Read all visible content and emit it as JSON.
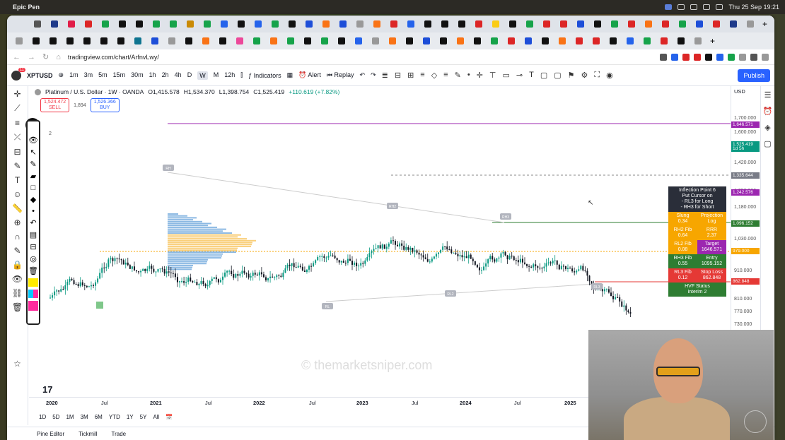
{
  "menubar": {
    "app_name": "Epic Pen",
    "datetime": "Thu 25 Sep  19:21"
  },
  "browser": {
    "url": "tradingview.com/chart/ArfnvLwy/"
  },
  "header": {
    "symbol": "XPTUSD",
    "avatar_badge": "11",
    "timeframes": [
      "1m",
      "3m",
      "5m",
      "15m",
      "30m",
      "1h",
      "2h",
      "4h",
      "D",
      "W",
      "M",
      "12h"
    ],
    "active_timeframe": "W",
    "indicators_label": "Indicators",
    "alert_label": "Alert",
    "replay_label": "Replay",
    "publish_label": "Publish"
  },
  "legend": {
    "title": "Platinum / U.S. Dollar · 1W · OANDA",
    "open": "O1,415.578",
    "high": "H1,534.370",
    "low": "L1,398.754",
    "close": "C1,525.419",
    "change": "+110.619 (+7.82%)"
  },
  "trade": {
    "sell_price": "1,524.472",
    "sell_label": "SELL",
    "spread": "1,894",
    "buy_price": "1,526.366",
    "buy_label": "BUY"
  },
  "price_axis": {
    "currency": "USD",
    "ticks": [
      "1,700.000",
      "1,600.000",
      "1,420.000",
      "1,350.000",
      "1,180.000",
      "1,030.000",
      "910.000",
      "810.000",
      "770.000",
      "730.000",
      "690.000"
    ],
    "tags": [
      {
        "text": "1,646.571",
        "color": "#9c27b0"
      },
      {
        "text": "1,525.419",
        "color": "#089981"
      },
      {
        "text": "1d 5h",
        "color": "#089981"
      },
      {
        "text": "1,335.644",
        "color": "#787b86"
      },
      {
        "text": "1,242.576",
        "color": "#9c27b0"
      },
      {
        "text": "1,096.152",
        "color": "#2e7d32"
      },
      {
        "text": "979.000",
        "color": "#f7a600"
      },
      {
        "text": "862.848",
        "color": "#e53935"
      }
    ]
  },
  "pivot_labels": [
    "RH",
    "RH2",
    "RH3",
    "RL",
    "RL2",
    "RL3"
  ],
  "info_panel": {
    "header": [
      "Inflection Point 6",
      "Put Cursor on",
      "- RL3 for Long",
      "- RH3 for Short"
    ],
    "rows": [
      {
        "left": "Slung\n0.34",
        "right": "Projection\nLog",
        "lc": "#f7a600",
        "rc": "#f7a600"
      },
      {
        "left": "RH2 Fib\n0.64",
        "right": "RRR\n2.37",
        "lc": "#f7a600",
        "rc": "#f7a600"
      },
      {
        "left": "RL2 Fib\n0.08",
        "right": "Target\n1646.571",
        "lc": "#f7a600",
        "rc": "#9c27b0"
      },
      {
        "left": "RH3 Fib\n0.55",
        "right": "Entry\n1095.152",
        "lc": "#2e7d32",
        "rc": "#2e7d32"
      },
      {
        "left": "RL3 Fib\n0.12",
        "right": "Stop Loss\n862.848",
        "lc": "#e53935",
        "rc": "#e53935"
      }
    ],
    "footer": "HVF Status\ninterim 2",
    "footer_color": "#2e7d32"
  },
  "watermark": "© themarketsniper.com",
  "time_axis": [
    "2020",
    "Jul",
    "2021",
    "Jul",
    "2022",
    "Jul",
    "2023",
    "Jul",
    "2024",
    "Jul",
    "2025"
  ],
  "ranges": [
    "1D",
    "5D",
    "1M",
    "3M",
    "6M",
    "YTD",
    "1Y",
    "5Y",
    "All"
  ],
  "bottom_tabs": [
    "Pine Editor",
    "Tickmill",
    "Trade"
  ],
  "chart_badge_2": "2"
}
